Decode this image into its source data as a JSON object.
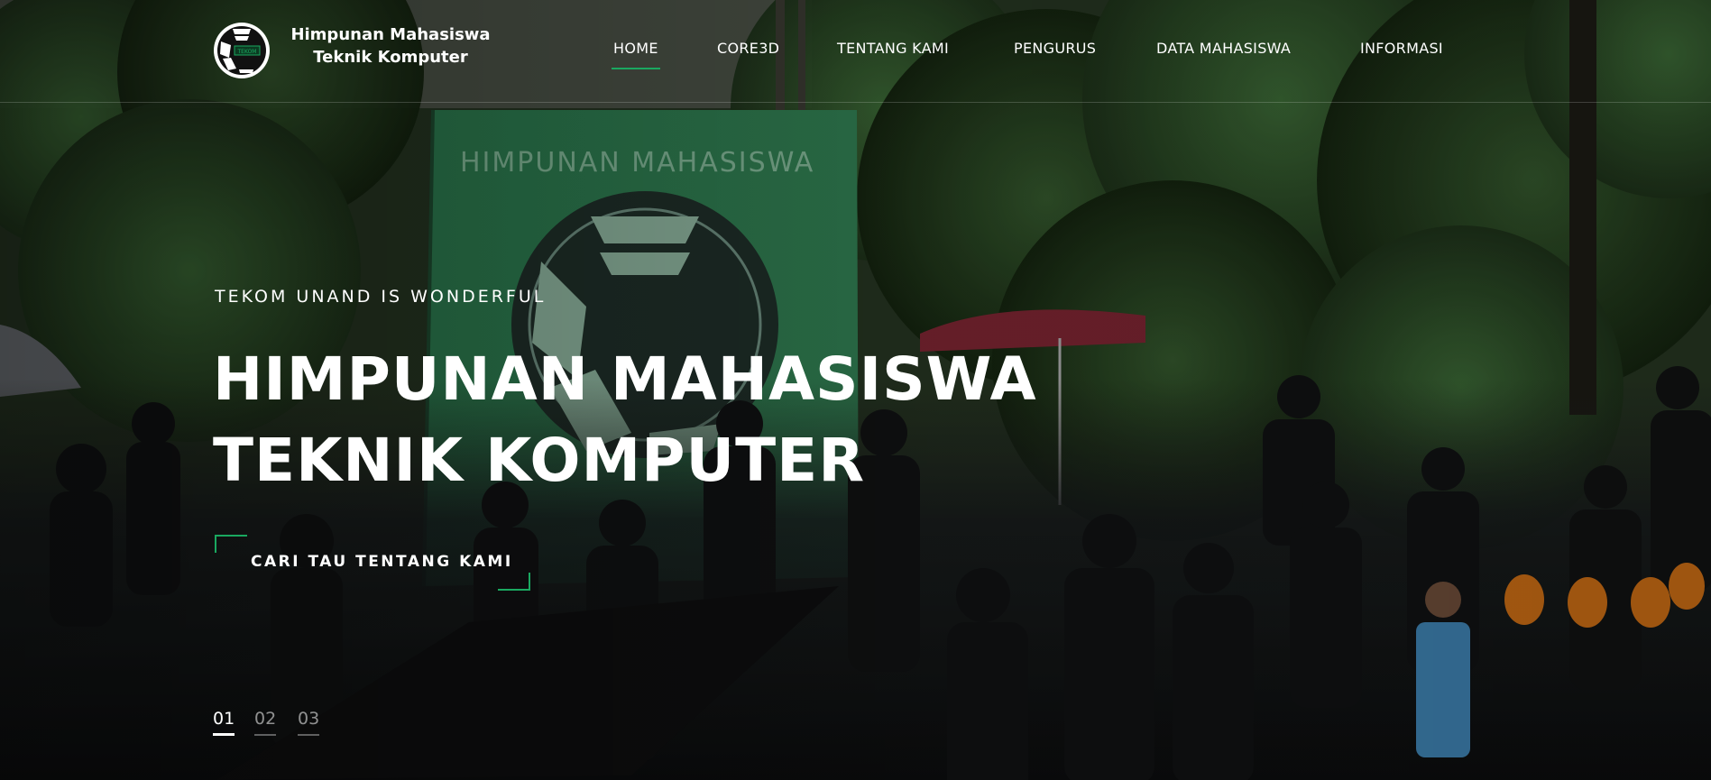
{
  "header": {
    "logo_alt": "HIMA TEKOM logo",
    "site_name_line1": "Himpunan Mahasiswa",
    "site_name_line2": "Teknik Komputer",
    "logo_text": "TEKOM"
  },
  "nav": {
    "items": [
      {
        "label": "HOME",
        "active": true
      },
      {
        "label": "CORE3D",
        "active": false
      },
      {
        "label": "TENTANG KAMI",
        "active": false
      },
      {
        "label": "PENGURUS",
        "active": false
      },
      {
        "label": "DATA MAHASISWA",
        "active": false
      },
      {
        "label": "INFORMASI",
        "active": false
      }
    ]
  },
  "hero": {
    "tagline": "TEKOM UNAND IS WONDERFUL",
    "title_line1": "HIMPUNAN MAHASISWA",
    "title_line2": "TEKNIK KOMPUTER",
    "cta_label": "CARI TAU TENTANG KAMI",
    "banner_text": "HIMPUNAN MAHASISWA"
  },
  "pager": {
    "items": [
      "01",
      "02",
      "03"
    ],
    "active_index": 0
  },
  "colors": {
    "accent": "#1aa860",
    "banner_green": "#2f8a58",
    "foliage": "#2b4a2a"
  }
}
